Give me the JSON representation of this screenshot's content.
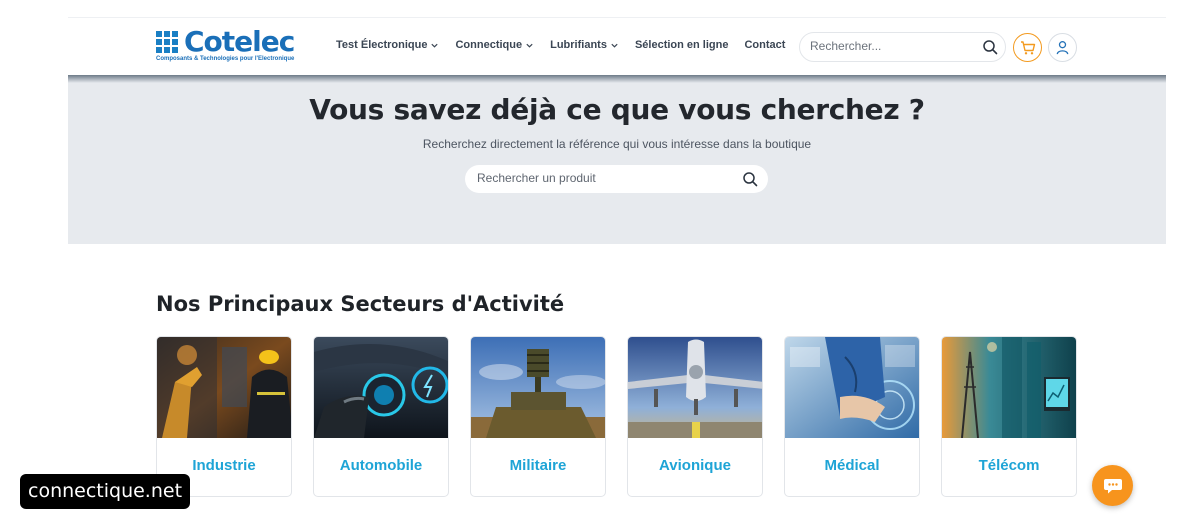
{
  "header": {
    "logo_name": "Cotelec",
    "logo_tagline": "Composants & Technologies pour l'Electronique",
    "nav": [
      {
        "label": "Test Électronique",
        "has_dropdown": true
      },
      {
        "label": "Connectique",
        "has_dropdown": true
      },
      {
        "label": "Lubrifiants",
        "has_dropdown": true
      },
      {
        "label": "Sélection en ligne",
        "has_dropdown": false
      },
      {
        "label": "Contact",
        "has_dropdown": false
      }
    ],
    "search_placeholder": "Rechercher...",
    "icons": [
      "search-icon",
      "cart-icon",
      "user-icon"
    ],
    "accent_color": "#f39a1f"
  },
  "hero": {
    "title": "Vous savez déjà ce que vous cherchez ?",
    "subtitle": "Recherchez directement la référence qui vous intéresse dans la boutique",
    "search_placeholder": "Rechercher un produit"
  },
  "sectors": {
    "title": "Nos Principaux Secteurs d'Activité",
    "items": [
      {
        "label": "Industrie"
      },
      {
        "label": "Automobile"
      },
      {
        "label": "Militaire"
      },
      {
        "label": "Avionique"
      },
      {
        "label": "Médical"
      },
      {
        "label": "Télécom"
      }
    ],
    "label_color": "#1ea4d6"
  },
  "watermark": "connectique.net",
  "chat_button_color": "#f7941d"
}
